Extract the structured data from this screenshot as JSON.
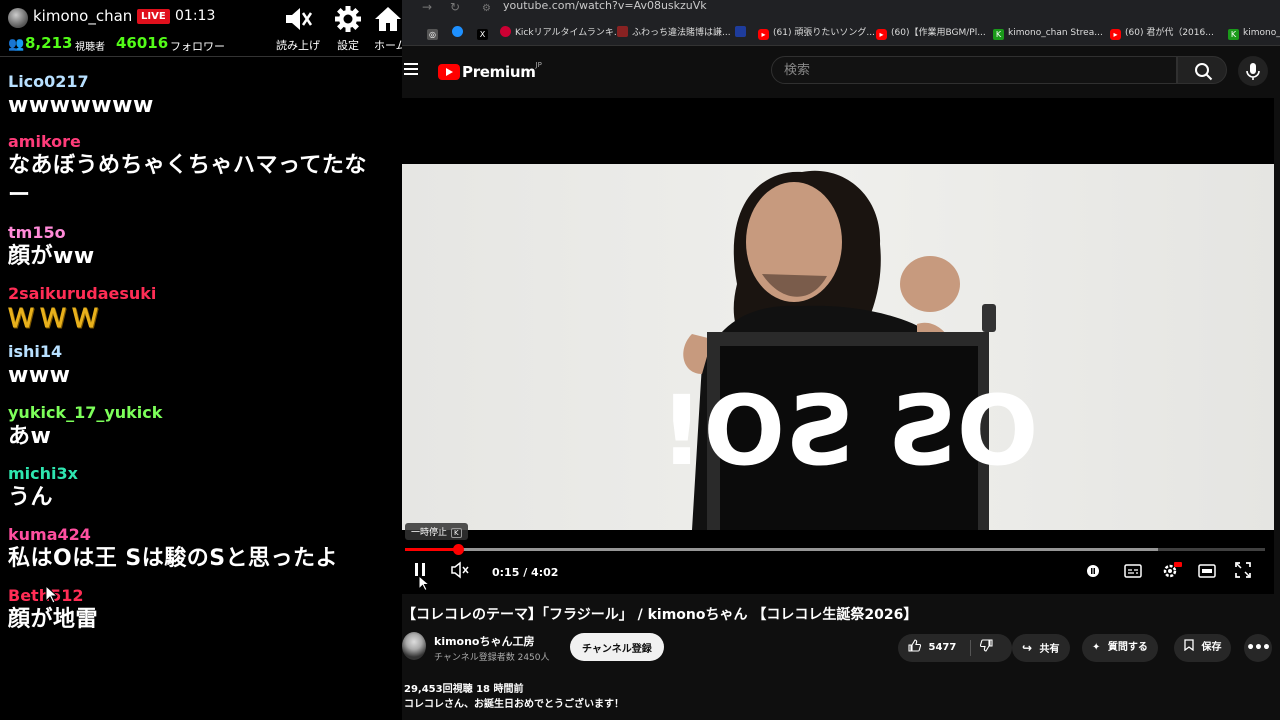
{
  "chat": {
    "header": {
      "channel_name": "kimono_chan",
      "live_badge": "LIVE",
      "elapsed": "01:13",
      "viewers": "8,213",
      "viewers_label": "視聴者",
      "followers": "46016",
      "followers_label": "フォロワー",
      "buttons": [
        {
          "label": "読み上げ",
          "icon": "speaker-mute-icon"
        },
        {
          "label": "設定",
          "icon": "gear-icon"
        },
        {
          "label": "ホーム",
          "icon": "home-icon"
        }
      ]
    },
    "messages": [
      {
        "user": "Lico0217",
        "color": "#b8e0ff",
        "text": "wwwwwww"
      },
      {
        "user": "amikore",
        "color": "#ff3c7a",
        "text": "なあぼうめちゃくちゃハマってたな",
        "text2": "ー"
      },
      {
        "user": "tm15o",
        "color": "#ff8ad8",
        "text": "顔がww"
      },
      {
        "user": "2saikurudaesuki",
        "color": "#ff2d55",
        "text": "ＷＷＷ",
        "emote": true
      },
      {
        "user": "ishi14",
        "color": "#b8e0ff",
        "text": "www"
      },
      {
        "user": "yukick_17_yukick",
        "color": "#7dff5a",
        "text": "あw"
      },
      {
        "user": "michi3x",
        "color": "#2ee6b0",
        "text": "うん"
      },
      {
        "user": "kuma424",
        "color": "#ff4fa0",
        "text": "私はOは王 Sは駿のSと思ったよ"
      },
      {
        "user": "Beth512",
        "color": "#ff2d55",
        "text": "顔が地雷"
      }
    ]
  },
  "browser": {
    "url": "youtube.com/watch?v=Av08uskzuVk",
    "bookmarks": [
      {
        "label": "",
        "color": "#555"
      },
      {
        "label": "",
        "color": "#1e90ff"
      },
      {
        "label": "",
        "color": "#000"
      },
      {
        "label": "Kickリアルタイムランキ...",
        "color": "#c03"
      },
      {
        "label": "ふわっち違法賭博は謙...",
        "color": "#822"
      },
      {
        "label": "",
        "color": "#1e3c9c"
      },
      {
        "label": "(61) 頑張りたいソング...",
        "color": "#f00"
      },
      {
        "label": "(60)【作業用BGM/Pl...",
        "color": "#f00"
      },
      {
        "label": "kimono_chan Strea...",
        "color": "#1a9a1a"
      },
      {
        "label": "(60) 君が代（2016...",
        "color": "#f00"
      },
      {
        "label": "kimono_",
        "color": "#1a9a1a"
      }
    ]
  },
  "youtube": {
    "logo_text": "Premium",
    "logo_region": "JP",
    "search_placeholder": "検索",
    "player": {
      "tooltip": "一時停止",
      "tooltip_key": "K",
      "time": "0:15 / 4:02",
      "played_fraction": 0.0615,
      "buffered_fraction": 0.875,
      "box_text": "OS SO!"
    },
    "video": {
      "title": "【コレコレのテーマ】「フラジール」 / kimonoちゃん 【コレコレ生誕祭2026】",
      "channel": "kimonoちゃん工房",
      "subscribers": "チャンネル登録者数 2450人",
      "subscribe_label": "チャンネル登録",
      "likes": "5477",
      "share_label": "共有",
      "ask_label": "質問する",
      "save_label": "保存",
      "views_time": "29,453回視聴 18 時間前",
      "description": "コレコレさん、お誕生日おめでとうございます！"
    }
  }
}
